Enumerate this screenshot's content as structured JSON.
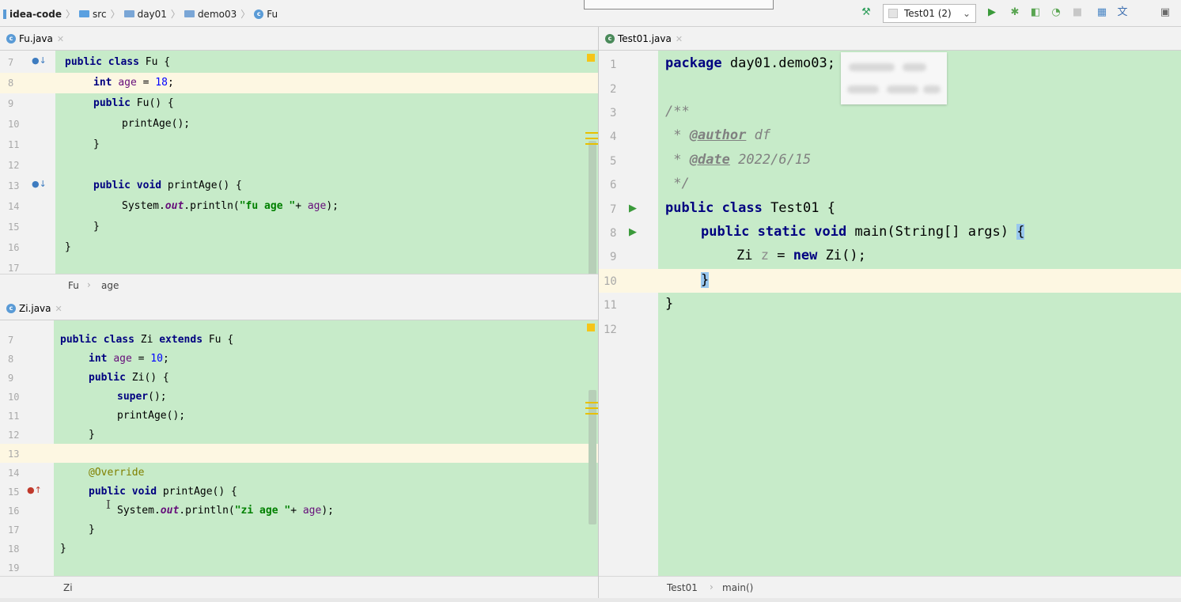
{
  "breadcrumb": [
    "idea-code",
    "src",
    "day01",
    "demo03",
    "Fu"
  ],
  "toolbar": {
    "run_config": "Test01 (2)"
  },
  "editors": {
    "fu": {
      "tab": "Fu.java",
      "lines": [
        "7",
        "8",
        "9",
        "10",
        "11",
        "12",
        "13",
        "14",
        "15",
        "16",
        "17"
      ],
      "crumbs": [
        "Fu",
        "age"
      ],
      "code": {
        "l7": {
          "kw": "public class",
          "rest": " Fu {"
        },
        "l8": {
          "kw": "int",
          "field": "age",
          "op": " = ",
          "num": "18",
          "end": ";"
        },
        "l9": {
          "kw": "public",
          "rest": " Fu() {"
        },
        "l10": "printAge();",
        "l11": "}",
        "l13": {
          "kw": "public void",
          "rest": " printAge() {"
        },
        "l14": {
          "pre": "System.",
          "static": "out",
          "mid": ".println(",
          "str": "\"fu age \"",
          "plus": "+ ",
          "field": "age",
          "end": ");"
        },
        "l15": "}",
        "l16": "}"
      }
    },
    "zi": {
      "tab": "Zi.java",
      "lines": [
        "7",
        "8",
        "9",
        "10",
        "11",
        "12",
        "13",
        "14",
        "15",
        "16",
        "17",
        "18",
        "19"
      ],
      "crumbs": [
        "Zi"
      ],
      "code": {
        "l7": {
          "kw1": "public class",
          "mid": " Zi ",
          "kw2": "extends",
          "rest": " Fu {"
        },
        "l8": {
          "kw": "int",
          "field": "age",
          "op": " = ",
          "num": "10",
          "end": ";"
        },
        "l9": {
          "kw": "public",
          "rest": " Zi() {"
        },
        "l10": {
          "kw": "super",
          "rest": "();"
        },
        "l11": "printAge();",
        "l12": "}",
        "l14": "@Override",
        "l15": {
          "kw": "public void",
          "rest": " printAge() {"
        },
        "l16": {
          "pre": "System.",
          "static": "out",
          "mid": ".println(",
          "str": "\"zi age \"",
          "plus": "+ ",
          "field": "age",
          "end": ");"
        },
        "l17": "}",
        "l18": "}"
      }
    },
    "test": {
      "tab": "Test01.java",
      "lines": [
        "1",
        "2",
        "3",
        "4",
        "5",
        "6",
        "7",
        "8",
        "9",
        "10",
        "11",
        "12"
      ],
      "crumbs": [
        "Test01",
        "main()"
      ],
      "code": {
        "l1": {
          "kw": "package",
          "rest": " day01.demo03;"
        },
        "l3": "/**",
        "l4": {
          "pre": " * ",
          "tag": "@author",
          "rest": " df"
        },
        "l5": {
          "pre": " * ",
          "tag": "@date",
          "rest": " 2022/6/15"
        },
        "l6": " */",
        "l7": {
          "kw": "public class",
          "rest": " Test01 {"
        },
        "l8": {
          "kw": "public static void",
          "rest": " main(String[] args) ",
          "brace": "{"
        },
        "l9": {
          "pre": "Zi ",
          "var": "z",
          "op": " = ",
          "kw": "new",
          "rest": " Zi();"
        },
        "l10": "}",
        "l11": "}"
      }
    }
  }
}
